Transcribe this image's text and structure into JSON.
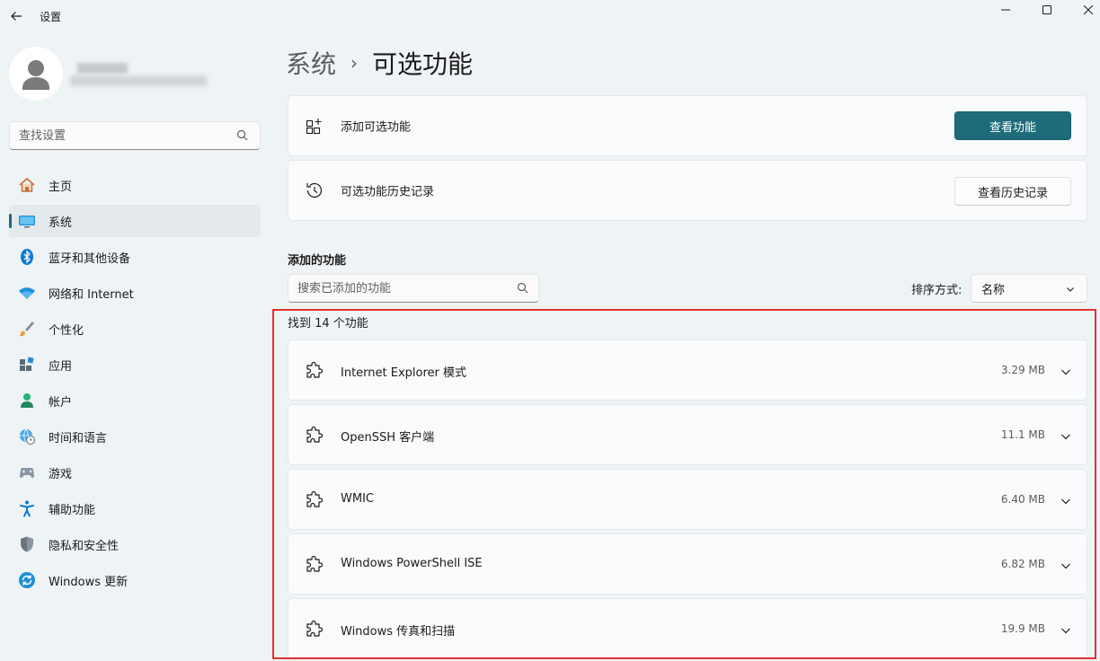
{
  "window": {
    "title": "设置"
  },
  "sidebar": {
    "search_placeholder": "查找设置",
    "items": [
      {
        "label": "主页",
        "icon": "home-icon"
      },
      {
        "label": "系统",
        "icon": "system-icon",
        "active": true
      },
      {
        "label": "蓝牙和其他设备",
        "icon": "bluetooth-icon"
      },
      {
        "label": "网络和 Internet",
        "icon": "wifi-icon"
      },
      {
        "label": "个性化",
        "icon": "brush-icon"
      },
      {
        "label": "应用",
        "icon": "apps-icon"
      },
      {
        "label": "帐户",
        "icon": "account-icon"
      },
      {
        "label": "时间和语言",
        "icon": "globe-clock-icon"
      },
      {
        "label": "游戏",
        "icon": "gamepad-icon"
      },
      {
        "label": "辅助功能",
        "icon": "accessibility-icon"
      },
      {
        "label": "隐私和安全性",
        "icon": "shield-icon"
      },
      {
        "label": "Windows 更新",
        "icon": "update-icon"
      }
    ]
  },
  "breadcrumb": {
    "parent": "系统",
    "separator": "›",
    "current": "可选功能"
  },
  "add_card": {
    "label": "添加可选功能",
    "button": "查看功能",
    "icon": "add-feature-icon"
  },
  "history_card": {
    "label": "可选功能历史记录",
    "button": "查看历史记录",
    "icon": "history-icon"
  },
  "installed": {
    "title": "添加的功能",
    "search_placeholder": "搜索已添加的功能",
    "sort_label": "排序方式:",
    "sort_value": "名称",
    "found_text": "找到 14 个功能",
    "features": [
      {
        "name": "Internet Explorer 模式",
        "size": "3.29 MB"
      },
      {
        "name": "OpenSSH 客户端",
        "size": "11.1 MB"
      },
      {
        "name": "WMIC",
        "size": "6.40 MB"
      },
      {
        "name": "Windows PowerShell ISE",
        "size": "6.82 MB"
      },
      {
        "name": "Windows 传真和扫描",
        "size": "19.9 MB"
      }
    ]
  },
  "colors": {
    "accent": "#1e6b7a",
    "background": "#eef3f6",
    "card": "#f9fbfc",
    "highlight": "#e03232"
  }
}
